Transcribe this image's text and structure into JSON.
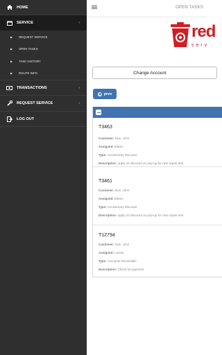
{
  "sidebar": {
    "items": [
      {
        "label": "HOME",
        "icon": "home-icon"
      },
      {
        "label": "SERVICE",
        "icon": "calendar-icon",
        "expanded": true
      },
      {
        "label": "TRANSACTIONS",
        "icon": "money-icon"
      },
      {
        "label": "REQUEST SERVICE",
        "icon": "wrench-icon"
      },
      {
        "label": "LOG OUT",
        "icon": "logout-icon"
      }
    ],
    "service_subitems": [
      {
        "label": "REQUEST SERVICE"
      },
      {
        "label": "OPEN TASKS"
      },
      {
        "label": "TASK HISTORY"
      },
      {
        "label": "ROUTE INFO"
      }
    ]
  },
  "header": {
    "title": "OPEN TASKS"
  },
  "logo": {
    "text": "red",
    "subtext": "serv"
  },
  "change_account_label": "Change Account",
  "prev_label": "prev",
  "labels": {
    "customer": "Customer:",
    "assigned": "Assigned:",
    "type": "Type:",
    "description": "Description:"
  },
  "tasks": [
    {
      "id": "T3463",
      "customer": "Doe, John",
      "assigned": "Eileen",
      "type": "Anniversary Discount",
      "description": "Apply 10 discount on pop-up for next repair and"
    },
    {
      "id": "T3461",
      "customer": "Doe, John",
      "assigned": "Eileen",
      "type": "Anniversary Discount",
      "description": "Apply 10 discount on pop-up for next repair and"
    },
    {
      "id": "T12794",
      "customer": "Doe, John",
      "assigned": "Lonnie",
      "type": "Accounts Receivable",
      "description": "Check for payment"
    }
  ],
  "colors": {
    "accent": "#3f74b0",
    "brand": "#cf1f25",
    "sidebar": "#2f2f2f"
  }
}
